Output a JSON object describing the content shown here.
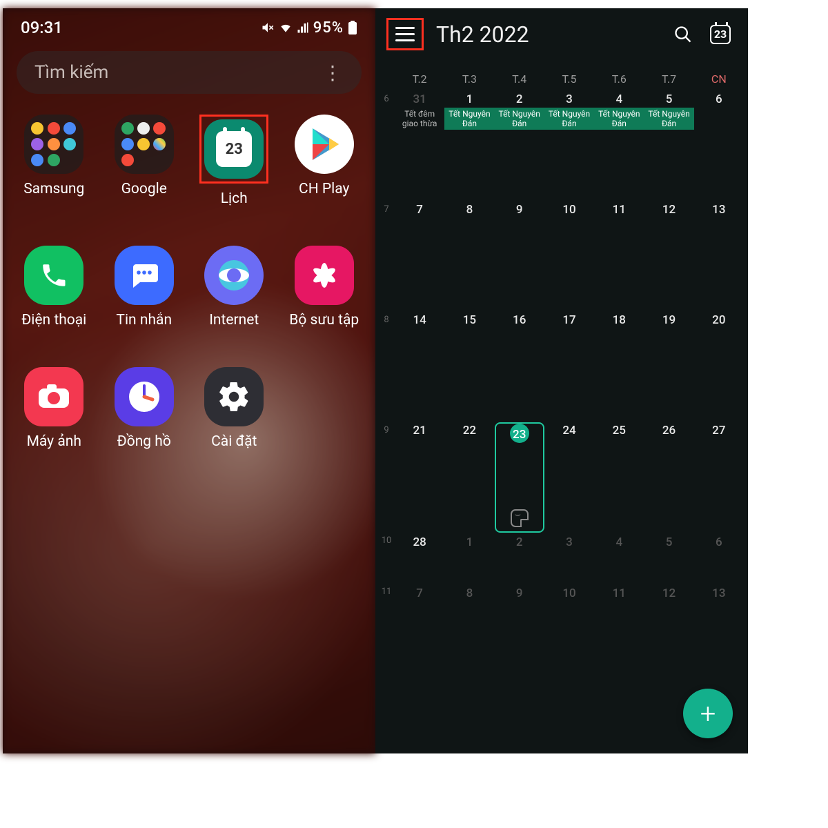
{
  "left": {
    "status": {
      "time": "09:31",
      "battery_text": "95%"
    },
    "search": {
      "placeholder": "Tìm kiếm"
    },
    "apps": [
      {
        "label": "Samsung"
      },
      {
        "label": "Google"
      },
      {
        "label": "Lịch",
        "badge": "23",
        "highlighted": true
      },
      {
        "label": "CH Play"
      },
      {
        "label": "Điện thoại"
      },
      {
        "label": "Tin nhắn"
      },
      {
        "label": "Internet"
      },
      {
        "label": "Bộ sưu tập"
      },
      {
        "label": "Máy ảnh"
      },
      {
        "label": "Đồng hồ"
      },
      {
        "label": "Cài đặt"
      }
    ]
  },
  "right": {
    "title": "Th2  2022",
    "today_icon_day": "23",
    "menu_highlighted": true,
    "weekdays": [
      "T.2",
      "T.3",
      "T.4",
      "T.5",
      "T.6",
      "T.7",
      "CN"
    ],
    "weeks": [
      {
        "num": "6",
        "days": [
          {
            "n": "31",
            "other": true,
            "evt": "Tết đêm giao thừa",
            "evt_first": true
          },
          {
            "n": "1",
            "evt": "Tết Nguyên Đán"
          },
          {
            "n": "2",
            "evt": "Tết Nguyên Đán"
          },
          {
            "n": "3",
            "evt": "Tết Nguyên Đán"
          },
          {
            "n": "4",
            "evt": "Tết Nguyên Đán"
          },
          {
            "n": "5",
            "evt": "Tết Nguyên Đán"
          },
          {
            "n": "6"
          }
        ]
      },
      {
        "num": "7",
        "days": [
          {
            "n": "7"
          },
          {
            "n": "8"
          },
          {
            "n": "9"
          },
          {
            "n": "10"
          },
          {
            "n": "11"
          },
          {
            "n": "12"
          },
          {
            "n": "13"
          }
        ]
      },
      {
        "num": "8",
        "days": [
          {
            "n": "14"
          },
          {
            "n": "15"
          },
          {
            "n": "16"
          },
          {
            "n": "17"
          },
          {
            "n": "18"
          },
          {
            "n": "19"
          },
          {
            "n": "20"
          }
        ]
      },
      {
        "num": "9",
        "days": [
          {
            "n": "21"
          },
          {
            "n": "22"
          },
          {
            "n": "23",
            "today": true,
            "sticker": true
          },
          {
            "n": "24"
          },
          {
            "n": "25"
          },
          {
            "n": "26"
          },
          {
            "n": "27"
          }
        ]
      },
      {
        "num": "10",
        "short": true,
        "days": [
          {
            "n": "28"
          },
          {
            "n": "1",
            "other": true
          },
          {
            "n": "2",
            "other": true
          },
          {
            "n": "3",
            "other": true
          },
          {
            "n": "4",
            "other": true
          },
          {
            "n": "5",
            "other": true
          },
          {
            "n": "6",
            "other": true
          }
        ]
      },
      {
        "num": "11",
        "short": true,
        "days": [
          {
            "n": "7",
            "other": true
          },
          {
            "n": "8",
            "other": true
          },
          {
            "n": "9",
            "other": true
          },
          {
            "n": "10",
            "other": true
          },
          {
            "n": "11",
            "other": true
          },
          {
            "n": "12",
            "other": true
          },
          {
            "n": "13",
            "other": true
          }
        ]
      }
    ]
  }
}
